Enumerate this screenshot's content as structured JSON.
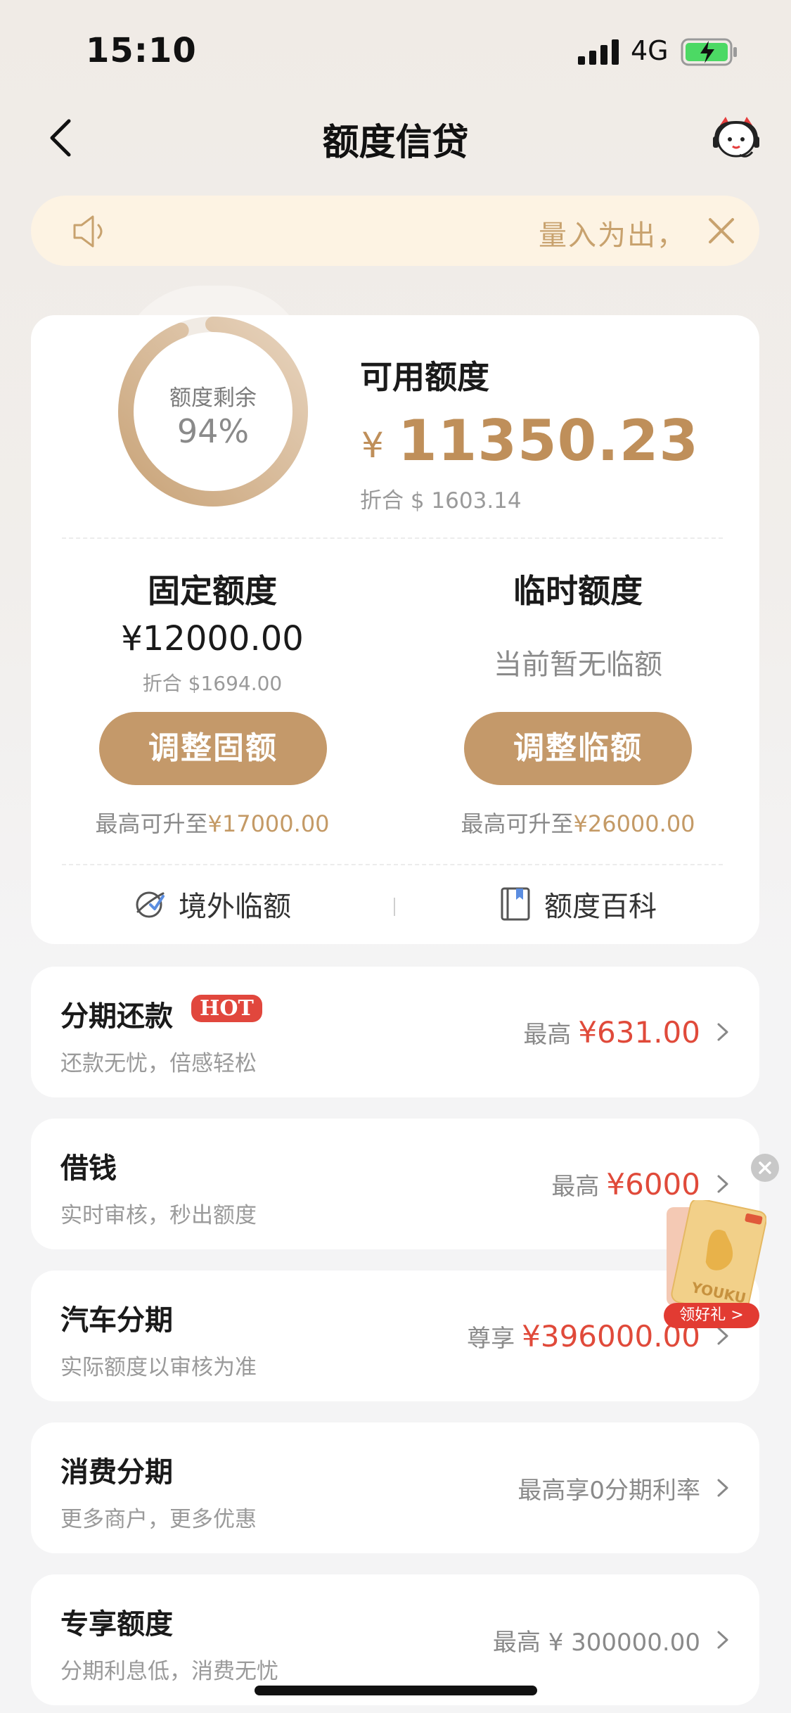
{
  "status_bar": {
    "time": "15:10",
    "network": "4G"
  },
  "nav": {
    "title": "额度信贷"
  },
  "notice": {
    "text": "量入为出，"
  },
  "credit": {
    "ring_label": "额度剩余",
    "ring_percent": "94%",
    "remaining_fraction": 0.94,
    "available_label": "可用额度",
    "currency_symbol": "¥",
    "available_amount": "11350.23",
    "available_usd": "折合 $ 1603.14"
  },
  "fixed": {
    "title": "固定额度",
    "amount": "¥12000.00",
    "usd": "折合 $1694.00",
    "button": "调整固额",
    "max_prefix": "最高可升至",
    "max_value": "¥17000.00"
  },
  "temporary": {
    "title": "临时额度",
    "none_text": "当前暂无临额",
    "button": "调整临额",
    "max_prefix": "最高可升至",
    "max_value": "¥26000.00"
  },
  "links": {
    "overseas": "境外临额",
    "encyclopedia": "额度百科"
  },
  "items": [
    {
      "title": "分期还款",
      "badge": "HOT",
      "subtitle": "还款无忧，倍感轻松",
      "prefix": "最高",
      "value": "¥631.00"
    },
    {
      "title": "借钱",
      "subtitle": "实时审核，秒出额度",
      "prefix": "最高",
      "value": "¥6000"
    },
    {
      "title": "汽车分期",
      "subtitle": "实际额度以审核为准",
      "prefix": "尊享",
      "value": "¥396000.00"
    },
    {
      "title": "消费分期",
      "subtitle": "更多商户，更多优惠",
      "value_text": "最高享0分期利率"
    },
    {
      "title": "专享额度",
      "subtitle": "分期利息低，消费无忧",
      "value_text": "最高 ¥ 300000.00"
    }
  ],
  "gift": {
    "brand": "YOUKU",
    "button": "领好礼 >"
  },
  "colors": {
    "accent": "#c4996a",
    "gold_text": "#bf8f5a",
    "red": "#e04a3a",
    "notice_bg": "#fdf3e3"
  }
}
